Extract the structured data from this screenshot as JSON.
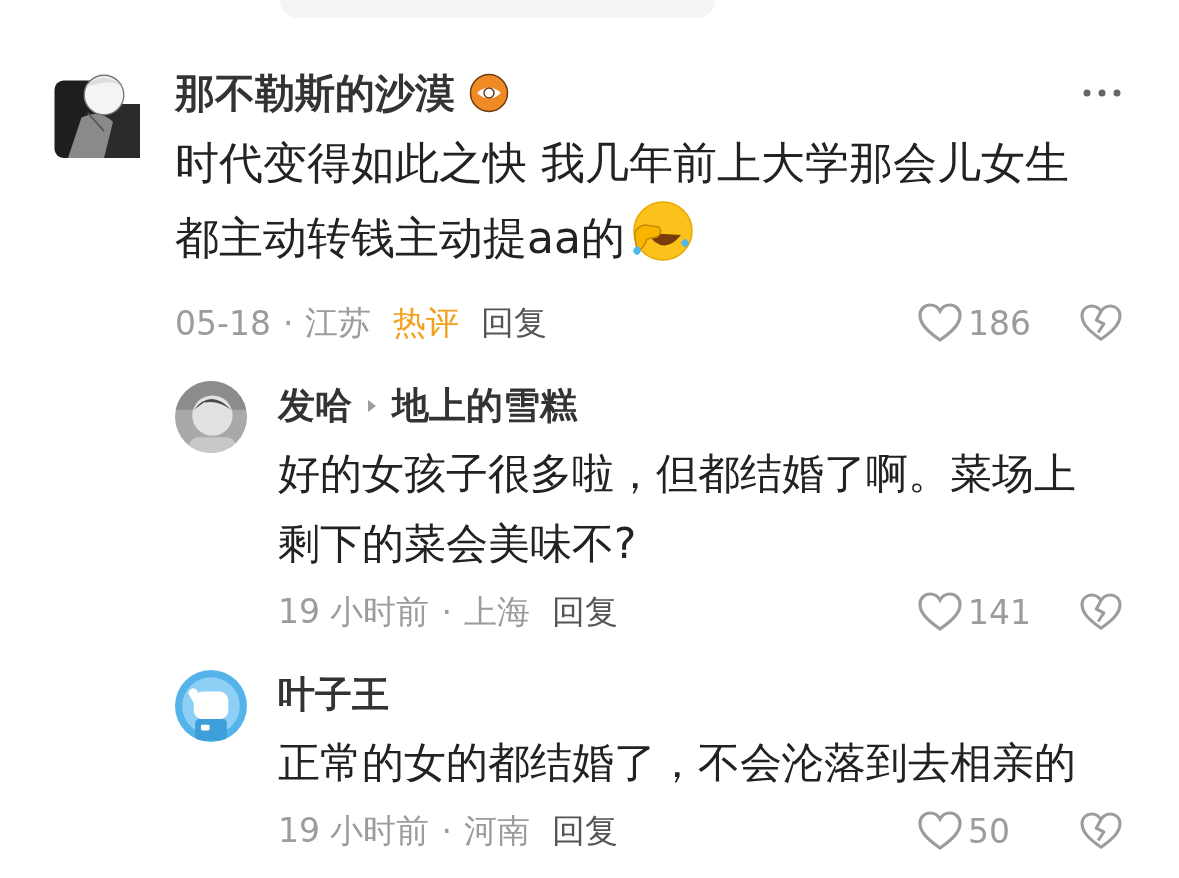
{
  "comments": [
    {
      "author": "那不勒斯的沙漠",
      "verified": true,
      "text": "时代变得如此之快 我几年前上大学那会儿女生都主动转钱主动提aa的",
      "trailing_emoji": true,
      "date": "05-18",
      "separator": "·",
      "location": "江苏",
      "hot_label": "热评",
      "reply_label": "回复",
      "likes": "186",
      "replies": [
        {
          "author": "发哈",
          "reply_to": "地上的雪糕",
          "text": "好的女孩子很多啦，但都结婚了啊。菜场上剩下的菜会美味不?",
          "date": "19 小时前",
          "separator": "·",
          "location": "上海",
          "reply_label": "回复",
          "likes": "141"
        },
        {
          "author": "叶子王",
          "text": "正常的女的都结婚了，不会沦落到去相亲的",
          "date": "19 小时前",
          "separator": "·",
          "location": "河南",
          "reply_label": "回复",
          "likes": "50"
        }
      ]
    }
  ]
}
